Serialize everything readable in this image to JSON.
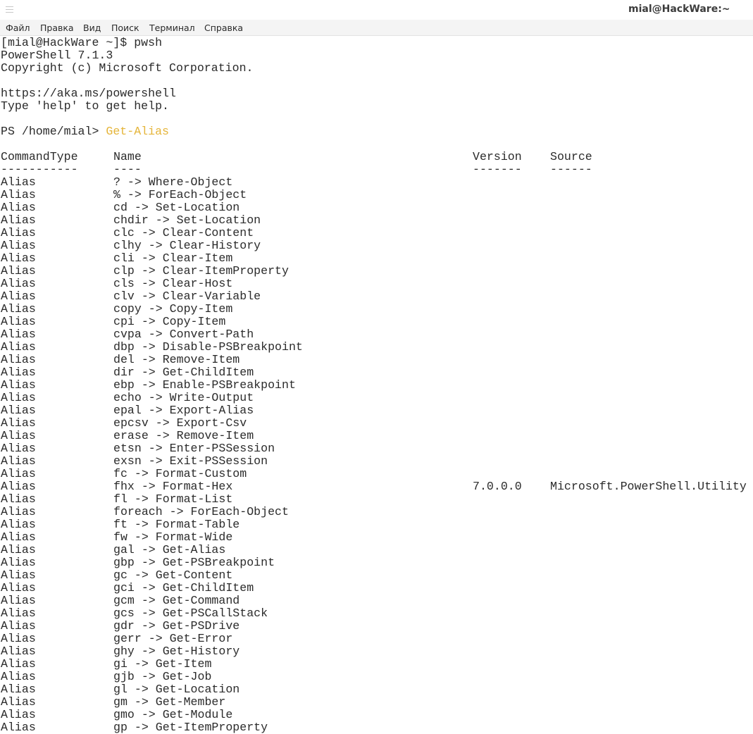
{
  "window": {
    "title": "mial@HackWare:~"
  },
  "menu": [
    "Файл",
    "Правка",
    "Вид",
    "Поиск",
    "Терминал",
    "Справка"
  ],
  "terminal": {
    "prompt_line": "[mial@HackWare ~]$ pwsh",
    "version_line": "PowerShell 7.1.3",
    "copyright_line": "Copyright (c) Microsoft Corporation.",
    "url_line": "https://aka.ms/powershell",
    "help_line": "Type 'help' to get help.",
    "ps_prompt": "PS /home/mial> ",
    "ps_command": "Get-Alias",
    "command_color": "#e5b53a",
    "headers": {
      "type": "CommandType",
      "name": "Name",
      "version": "Version",
      "source": "Source"
    },
    "separators": {
      "type": "-----------",
      "name": "----",
      "version": "-------",
      "source": "------"
    },
    "rows": [
      {
        "type": "Alias",
        "name": "? -> Where-Object",
        "version": "",
        "source": ""
      },
      {
        "type": "Alias",
        "name": "% -> ForEach-Object",
        "version": "",
        "source": ""
      },
      {
        "type": "Alias",
        "name": "cd -> Set-Location",
        "version": "",
        "source": ""
      },
      {
        "type": "Alias",
        "name": "chdir -> Set-Location",
        "version": "",
        "source": ""
      },
      {
        "type": "Alias",
        "name": "clc -> Clear-Content",
        "version": "",
        "source": ""
      },
      {
        "type": "Alias",
        "name": "clhy -> Clear-History",
        "version": "",
        "source": ""
      },
      {
        "type": "Alias",
        "name": "cli -> Clear-Item",
        "version": "",
        "source": ""
      },
      {
        "type": "Alias",
        "name": "clp -> Clear-ItemProperty",
        "version": "",
        "source": ""
      },
      {
        "type": "Alias",
        "name": "cls -> Clear-Host",
        "version": "",
        "source": ""
      },
      {
        "type": "Alias",
        "name": "clv -> Clear-Variable",
        "version": "",
        "source": ""
      },
      {
        "type": "Alias",
        "name": "copy -> Copy-Item",
        "version": "",
        "source": ""
      },
      {
        "type": "Alias",
        "name": "cpi -> Copy-Item",
        "version": "",
        "source": ""
      },
      {
        "type": "Alias",
        "name": "cvpa -> Convert-Path",
        "version": "",
        "source": ""
      },
      {
        "type": "Alias",
        "name": "dbp -> Disable-PSBreakpoint",
        "version": "",
        "source": ""
      },
      {
        "type": "Alias",
        "name": "del -> Remove-Item",
        "version": "",
        "source": ""
      },
      {
        "type": "Alias",
        "name": "dir -> Get-ChildItem",
        "version": "",
        "source": ""
      },
      {
        "type": "Alias",
        "name": "ebp -> Enable-PSBreakpoint",
        "version": "",
        "source": ""
      },
      {
        "type": "Alias",
        "name": "echo -> Write-Output",
        "version": "",
        "source": ""
      },
      {
        "type": "Alias",
        "name": "epal -> Export-Alias",
        "version": "",
        "source": ""
      },
      {
        "type": "Alias",
        "name": "epcsv -> Export-Csv",
        "version": "",
        "source": ""
      },
      {
        "type": "Alias",
        "name": "erase -> Remove-Item",
        "version": "",
        "source": ""
      },
      {
        "type": "Alias",
        "name": "etsn -> Enter-PSSession",
        "version": "",
        "source": ""
      },
      {
        "type": "Alias",
        "name": "exsn -> Exit-PSSession",
        "version": "",
        "source": ""
      },
      {
        "type": "Alias",
        "name": "fc -> Format-Custom",
        "version": "",
        "source": ""
      },
      {
        "type": "Alias",
        "name": "fhx -> Format-Hex",
        "version": "7.0.0.0",
        "source": "Microsoft.PowerShell.Utility"
      },
      {
        "type": "Alias",
        "name": "fl -> Format-List",
        "version": "",
        "source": ""
      },
      {
        "type": "Alias",
        "name": "foreach -> ForEach-Object",
        "version": "",
        "source": ""
      },
      {
        "type": "Alias",
        "name": "ft -> Format-Table",
        "version": "",
        "source": ""
      },
      {
        "type": "Alias",
        "name": "fw -> Format-Wide",
        "version": "",
        "source": ""
      },
      {
        "type": "Alias",
        "name": "gal -> Get-Alias",
        "version": "",
        "source": ""
      },
      {
        "type": "Alias",
        "name": "gbp -> Get-PSBreakpoint",
        "version": "",
        "source": ""
      },
      {
        "type": "Alias",
        "name": "gc -> Get-Content",
        "version": "",
        "source": ""
      },
      {
        "type": "Alias",
        "name": "gci -> Get-ChildItem",
        "version": "",
        "source": ""
      },
      {
        "type": "Alias",
        "name": "gcm -> Get-Command",
        "version": "",
        "source": ""
      },
      {
        "type": "Alias",
        "name": "gcs -> Get-PSCallStack",
        "version": "",
        "source": ""
      },
      {
        "type": "Alias",
        "name": "gdr -> Get-PSDrive",
        "version": "",
        "source": ""
      },
      {
        "type": "Alias",
        "name": "gerr -> Get-Error",
        "version": "",
        "source": ""
      },
      {
        "type": "Alias",
        "name": "ghy -> Get-History",
        "version": "",
        "source": ""
      },
      {
        "type": "Alias",
        "name": "gi -> Get-Item",
        "version": "",
        "source": ""
      },
      {
        "type": "Alias",
        "name": "gjb -> Get-Job",
        "version": "",
        "source": ""
      },
      {
        "type": "Alias",
        "name": "gl -> Get-Location",
        "version": "",
        "source": ""
      },
      {
        "type": "Alias",
        "name": "gm -> Get-Member",
        "version": "",
        "source": ""
      },
      {
        "type": "Alias",
        "name": "gmo -> Get-Module",
        "version": "",
        "source": ""
      },
      {
        "type": "Alias",
        "name": "gp -> Get-ItemProperty",
        "version": "",
        "source": ""
      }
    ]
  }
}
